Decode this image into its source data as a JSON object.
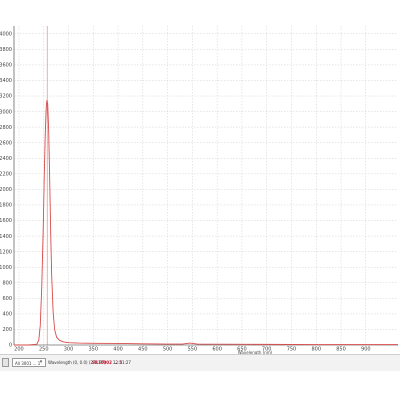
{
  "chart_data": {
    "type": "line",
    "title": "",
    "xlabel": "Wavelength (nm)",
    "ylabel": "",
    "xlim": [
      190,
      965
    ],
    "ylim": [
      0,
      4100
    ],
    "x_ticks": [
      200,
      250,
      300,
      350,
      400,
      450,
      500,
      550,
      600,
      650,
      700,
      750,
      800,
      850,
      900
    ],
    "y_ticks": [
      0,
      200,
      400,
      600,
      800,
      1000,
      1200,
      1400,
      1600,
      1800,
      2000,
      2200,
      2400,
      2600,
      2800,
      3000,
      3200,
      3400,
      3600,
      3800,
      4000
    ],
    "grid": true,
    "marker_x": 257,
    "series": [
      {
        "color": "#d94a4a",
        "x": [
          190,
          200,
          220,
          236,
          240,
          243,
          246,
          249,
          251,
          253,
          255,
          256.5,
          258,
          260,
          262,
          264,
          266,
          269,
          272,
          276,
          282,
          290,
          300,
          320,
          350,
          400,
          450,
          500,
          530,
          545,
          560,
          600,
          700,
          800,
          900,
          965
        ],
        "y": [
          0,
          0,
          0,
          10,
          60,
          250,
          750,
          1500,
          2150,
          2700,
          3050,
          3150,
          3100,
          2750,
          2150,
          1450,
          900,
          420,
          200,
          100,
          60,
          40,
          30,
          25,
          22,
          20,
          15,
          12,
          12,
          25,
          12,
          10,
          8,
          6,
          5,
          5
        ]
      }
    ]
  },
  "status_bar": {
    "marker_left": "0",
    "field1": "All 3001 ... 1",
    "field2": "Wavelength (0, 0.0) (271.77)",
    "field3_red": "SR10002 ... 5",
    "field4": "12:31:27"
  },
  "colors": {
    "series": "#d94a4a",
    "marker": "#e07a7a",
    "grid": "#cfcfcf",
    "axis": "#333333",
    "status_bg": "#f2f2f2",
    "status_red": "#c8102e"
  }
}
